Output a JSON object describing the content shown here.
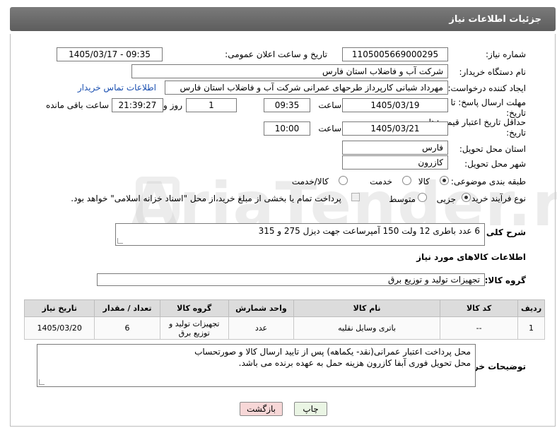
{
  "header": {
    "title": "جزئیات اطلاعات نیاز"
  },
  "fields": {
    "need_number_label": "شماره نیاز:",
    "need_number": "1105005669000295",
    "announce_label": "تاریخ و ساعت اعلان عمومی:",
    "announce_value": "1405/03/17 - 09:35",
    "buyer_org_label": "نام دستگاه خریدار:",
    "buyer_org": "شرکت آب و فاضلاب استان فارس",
    "requester_label": "ایجاد کننده درخواست:",
    "requester": "مهرداد شبانی کارپرداز طرحهای عمرانی  شرکت آب و فاضلاب استان فارس",
    "buyer_contact_link": "اطلاعات تماس خریدار",
    "deadline_label": "مهلت ارسال پاسخ: تا تاریخ:",
    "deadline_date": "1405/03/19",
    "time_label": "ساعت",
    "deadline_time": "09:35",
    "days_count": "1",
    "days_label": "روز و",
    "remaining_time": "21:39:27",
    "remaining_label": "ساعت باقی مانده",
    "min_price_label": "حداقل تاریخ اعتبار قیمت: تا تاریخ:",
    "min_price_date": "1405/03/21",
    "min_price_time": "10:00",
    "province_label": "استان محل تحویل:",
    "province": "فارس",
    "city_label": "شهر محل تحویل:",
    "city": "کازرون",
    "category_label": "طبقه بندی موضوعی:",
    "category_options": [
      "کالا",
      "خدمت",
      "کالا/خدمت"
    ],
    "category_selected": "کالا",
    "purchase_type_label": "نوع فرآیند خرید :",
    "purchase_options": [
      "جزیی",
      "متوسط"
    ],
    "purchase_selected": "جزیی",
    "payment_note": "پرداخت تمام یا بخشی از مبلغ خرید،از محل \"اسناد خزانه اسلامی\" خواهد بود."
  },
  "description": {
    "label": "شرح کلی نیاز:",
    "text": "6 عدد باطری 12 ولت 150 آمپرساعت جهت دیزل 275 و 315"
  },
  "goods": {
    "section_title": "اطلاعات کالاهای مورد نیاز",
    "group_label": "گروه کالا:",
    "group_value": "تجهیزات تولید و توزیع برق",
    "columns": [
      "ردیف",
      "کد کالا",
      "نام کالا",
      "واحد شمارش",
      "گروه کالا",
      "تعداد / مقدار",
      "تاریخ نیاز"
    ],
    "rows": [
      {
        "row": "1",
        "code": "--",
        "name": "باتری وسایل نقلیه",
        "unit": "عدد",
        "group": "تجهیزات تولید و توزیع برق",
        "qty": "6",
        "date": "1405/03/20"
      }
    ]
  },
  "buyer_notes": {
    "label": "توضیحات خریدار:",
    "line1": "محل پرداخت اعتبار عمرانی(نقد- یکماهه) پس از تایید ارسال کالا و صورتحساب",
    "line2": "محل تحویل فوری آبفا کازرون  هزینه حمل  به عهده برنده می باشد."
  },
  "buttons": {
    "print": "چاپ",
    "back": "بازگشت"
  },
  "watermark": "AriaTender.neT",
  "colors": {
    "header_bg": "#6b6b6b",
    "back_button_bg": "#f7d7d7",
    "print_button_bg": "#eaf5e4",
    "link": "#1a4fb0"
  }
}
